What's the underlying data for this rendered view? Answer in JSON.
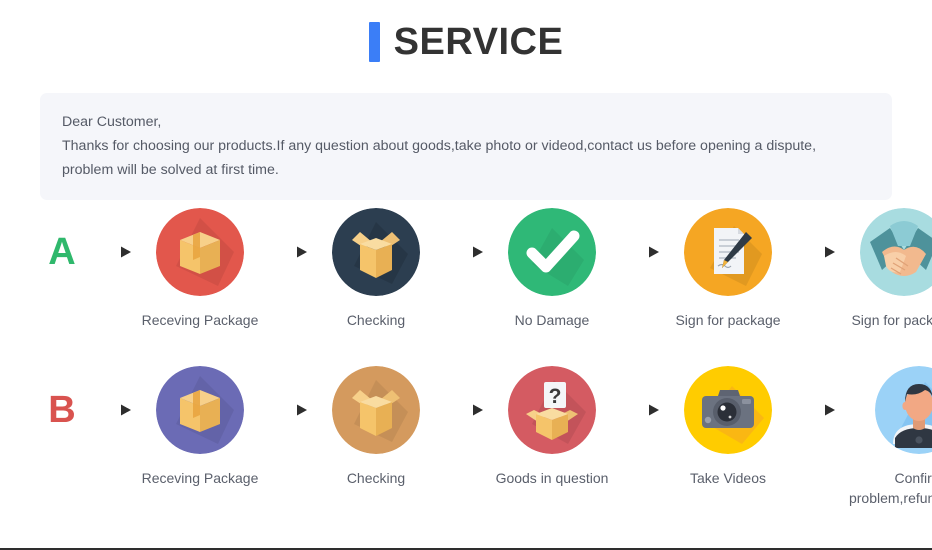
{
  "header": {
    "title": "SERVICE",
    "accent_color": "#3b7ef7"
  },
  "notice": {
    "line1": "Dear Customer,",
    "line2": "Thanks for choosing our products.If any question about goods,take photo or videod,contact us before opening a dispute,",
    "line3": "problem will be solved at first time.",
    "background_color": "#f5f6fa"
  },
  "flows": [
    {
      "letter": "A",
      "letter_color": "#2fb86c",
      "steps": [
        {
          "label": "Receving Package",
          "icon": "closed-box-icon",
          "circle_color": "#e2574c"
        },
        {
          "label": "Checking",
          "icon": "open-box-icon",
          "circle_color": "#2c3e50"
        },
        {
          "label": "No Damage",
          "icon": "check-mark-icon",
          "circle_color": "#2fb877"
        },
        {
          "label": "Sign for package",
          "icon": "document-pen-icon",
          "circle_color": "#f5a623"
        },
        {
          "label": "Sign for package",
          "icon": "handshake-icon",
          "circle_color": "#a8dce0"
        }
      ]
    },
    {
      "letter": "B",
      "letter_color": "#d9534f",
      "steps": [
        {
          "label": "Receving Package",
          "icon": "closed-box-icon",
          "circle_color": "#6b6bb5"
        },
        {
          "label": "Checking",
          "icon": "open-box-icon",
          "circle_color": "#d49a5e"
        },
        {
          "label": "Goods in question",
          "icon": "question-box-icon",
          "circle_color": "#d45b62"
        },
        {
          "label": "Take Videos",
          "icon": "camera-icon",
          "circle_color": "#ffcc00"
        },
        {
          "label": "Confirm problem,refund money",
          "icon": "person-avatar-icon",
          "circle_color": "#9bd2f7"
        }
      ]
    }
  ],
  "arrow": {
    "icon": "right-arrow-icon",
    "color": "#3a3a3a"
  }
}
